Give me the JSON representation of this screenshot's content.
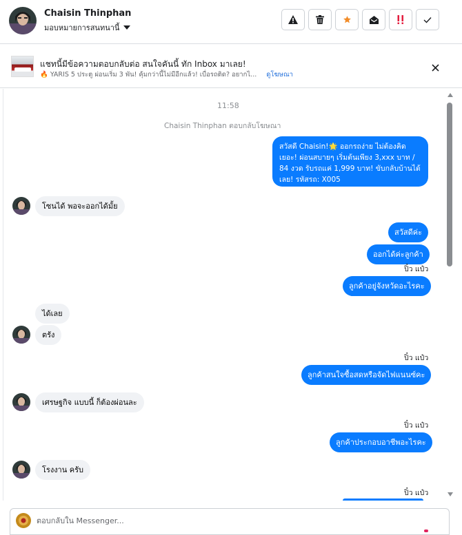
{
  "header": {
    "contact_name": "Chaisin Thinphan",
    "assign_label": "มอบหมายการสนทนานี้",
    "actions": [
      "warning-icon",
      "trash-icon",
      "star-icon",
      "mark-unread-icon",
      "spam-icon",
      "check-icon"
    ],
    "star_color": "#f28c28",
    "spam_color": "#e41e3f"
  },
  "ad": {
    "title": "แชทนี้มีข้อความตอบกลับต่อ สนใจคันนี้ ทัก Inbox มาเลย!",
    "subtitle": "🔥 YARIS 5 ประตู ผ่อนเริ่ม 3 พัน! คุ้มกว่านี้ไม่มีอีกแล้ว! เบื่อรถติด? อยากไ...",
    "link": "ดูโฆษณา"
  },
  "thread": {
    "timestamp": "11:58",
    "replied_note": "Chaisin Thinphan ตอบกลับโฆษณา",
    "messages": [
      {
        "dir": "out",
        "text": "สวัสดี Chaisin!🌟 ออกรถง่าย ไม่ต้องคิดเยอะ! ผ่อนสบายๆ เริ่มต้นเพียง 3,xxx บาท / 84 งวด รับรถแค่ 1,999 บาท! ขับกลับบ้านได้เลย! รหัสรถ: X005"
      },
      {
        "dir": "in",
        "text": "โซนได้ พอจะออกได้มั้ย"
      },
      {
        "dir": "out",
        "text": "สวัสดีค่ะ"
      },
      {
        "dir": "out",
        "text": "ออกได้ค่ะลูกค้า"
      },
      {
        "dir": "seen",
        "text": "ปิ๋ว แป๋ว"
      },
      {
        "dir": "out",
        "text": "ลูกค้าอยู่จังหวัดอะไรคะ"
      },
      {
        "dir": "in",
        "text": "ได้เลย"
      },
      {
        "dir": "in",
        "text": "ตรัง"
      },
      {
        "dir": "seen",
        "text": "ปิ๋ว แป๋ว"
      },
      {
        "dir": "out",
        "text": "ลูกค้าสนใจซื้อสดหรือจัดไฟแนนซ์คะ"
      },
      {
        "dir": "in",
        "text": "เศรษฐกิจ แบบนี้ ก็ต้องผ่อนละ"
      },
      {
        "dir": "seen",
        "text": "ปิ๋ว แป๋ว"
      },
      {
        "dir": "out",
        "text": "ลูกค้าประกอบอาชีพอะไรคะ"
      },
      {
        "dir": "in",
        "text": "โรงงาน ครับ"
      },
      {
        "dir": "seen",
        "text": "ปิ๋ว แป๋ว"
      }
    ]
  },
  "composer": {
    "placeholder": "ตอบกลับใน Messenger..."
  },
  "colors": {
    "outgoing_bubble": "#0a7cff",
    "incoming_bubble": "#f0f2f5",
    "link": "#216fdb"
  }
}
